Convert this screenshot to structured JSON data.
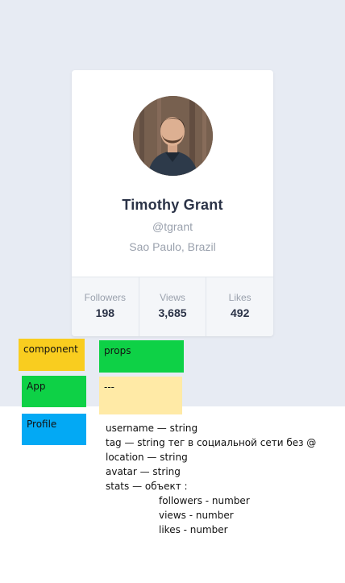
{
  "profile": {
    "name": "Timothy Grant",
    "tag": "@tgrant",
    "location": "Sao Paulo, Brazil",
    "stats": [
      {
        "label": "Followers",
        "value": "198"
      },
      {
        "label": "Views",
        "value": "3,685"
      },
      {
        "label": "Likes",
        "value": "492"
      }
    ]
  },
  "notes": {
    "component_label": "component",
    "props_label": "props",
    "app_label": "App",
    "app_props": "---",
    "profile_label": "Profile",
    "profile_props": [
      "username — string",
      "tag —  string тег в социальной сети без @",
      "location —  string",
      "avatar —  string",
      "stats — объект :",
      "followers - number",
      "views - number",
      "likes - number"
    ]
  },
  "colors": {
    "page_background": "#e7ebf3",
    "yellow": "#f9cd1f",
    "green": "#0ed146",
    "light_yellow": "#ffeaa6",
    "blue": "#03a9f4"
  }
}
